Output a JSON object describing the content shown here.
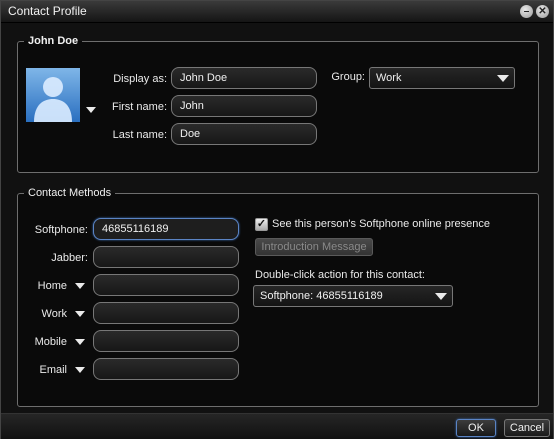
{
  "window": {
    "title": "Contact Profile",
    "minimize_glyph": "–",
    "close_glyph": "✕"
  },
  "profile": {
    "legend": "John Doe",
    "avatar_icon": "person-silhouette-icon",
    "display_as_label": "Display as:",
    "display_as_value": "John Doe",
    "first_name_label": "First name:",
    "first_name_value": "John",
    "last_name_label": "Last name:",
    "last_name_value": "Doe",
    "group_label": "Group:",
    "group_value": "Work"
  },
  "methods": {
    "legend": "Contact Methods",
    "softphone_label": "Softphone:",
    "softphone_value": "46855116189",
    "jabber_label": "Jabber:",
    "jabber_value": "",
    "home_label": "Home",
    "home_value": "",
    "work_label": "Work",
    "work_value": "",
    "mobile_label": "Mobile",
    "mobile_value": "",
    "email_label": "Email",
    "email_value": "",
    "presence_checkbox_label": "See this person's Softphone online presence",
    "presence_checked": true,
    "check_glyph": "✓",
    "intro_button_label": "Introduction Message",
    "double_click_label": "Double-click action for this contact:",
    "double_click_value": "Softphone: 46855116189"
  },
  "footer": {
    "ok_label": "OK",
    "cancel_label": "Cancel"
  },
  "colors": {
    "focus_border": "#5b84c4",
    "avatar_gradient_top": "#7fb6e8",
    "avatar_gradient_bottom": "#2a6fc0"
  }
}
